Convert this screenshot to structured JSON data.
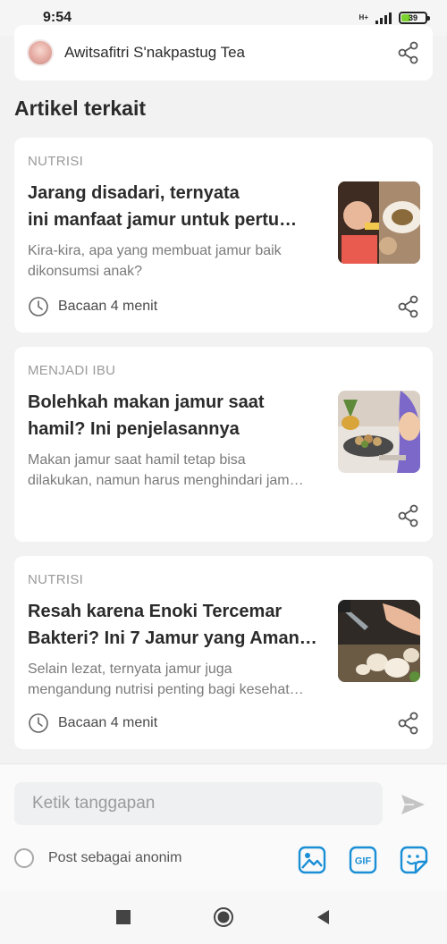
{
  "status_bar": {
    "time": "9:54",
    "network": "H+",
    "battery_level": "39"
  },
  "author": {
    "name": "Awitsafitri S'nakpastug Tea"
  },
  "section": {
    "title": "Artikel terkait"
  },
  "articles": [
    {
      "category": "NUTRISI",
      "title_line1": "Jarang disadari, ternyata",
      "title_line2": "ini manfaat jamur untuk pertu…",
      "desc_line1": "Kira-kira, apa yang membuat jamur baik",
      "desc_line2": "dikonsumsi anak?",
      "read_time": "Bacaan 4 menit",
      "thumb_icon": "child-eating-mushroom-photo"
    },
    {
      "category": "MENJADI IBU",
      "title_line1": "Bolehkah makan jamur saat",
      "title_line2": "hamil? Ini penjelasannya",
      "desc_line1": "Makan jamur saat hamil tetap bisa",
      "desc_line2": "dilakukan, namun harus menghindari jam…",
      "read_time": "",
      "thumb_icon": "pregnant-woman-mushroom-dish-photo"
    },
    {
      "category": "NUTRISI",
      "title_line1": "Resah karena Enoki Tercemar",
      "title_line2": "Bakteri? Ini 7 Jamur yang Aman…",
      "desc_line1": "Selain lezat, ternyata jamur juga",
      "desc_line2": "mengandung nutrisi penting bagi kesehat…",
      "read_time": "Bacaan 4 menit",
      "thumb_icon": "cutting-mushrooms-photo"
    }
  ],
  "comment": {
    "placeholder": "Ketik tanggapan",
    "anon_label": "Post sebagai anonim"
  },
  "media_buttons": {
    "image_icon": "image-icon",
    "gif_label": "GIF",
    "sticker_icon": "sticker-icon"
  },
  "colors": {
    "accent_blue": "#1a8fd6",
    "battery_green": "#7ad12f"
  }
}
